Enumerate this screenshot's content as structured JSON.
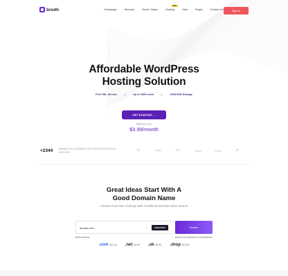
{
  "brand": {
    "name": "bredh",
    "accent": "#5b21b6",
    "signin_color": "#f0555b"
  },
  "nav": {
    "items": [
      {
        "label": "Homepage"
      },
      {
        "label": "Services"
      },
      {
        "label": "Server Status"
      },
      {
        "label": "Hosting",
        "badge": "New"
      },
      {
        "label": "Help"
      },
      {
        "label": "Pages"
      },
      {
        "label": "Contact Us"
      }
    ],
    "signin_label": "Sign in"
  },
  "hero": {
    "title_line1": "Affordable WordPress",
    "title_line2": "Hosting Solution",
    "features": [
      "Free SSL Service",
      "Up to 3400 users",
      "1008 SSD Storage"
    ],
    "cta_label": "GET STARTED  →",
    "starting_label": "Starting From",
    "price": "$3.99/month"
  },
  "clients": {
    "count": "+2344",
    "text": "BRANDS RELY ON BREDH FOR THEIR DATA HOSTING SERVICES",
    "logos": [
      "H",
      "stripe",
      "CLOUD",
      "DÖ",
      "brand",
      "envato",
      "H"
    ]
  },
  "domain": {
    "title_line1": "Great Ideas Start With A",
    "title_line2": "Good Domain Name",
    "subtitle": "Choose From 550+ Endings With Credits.Net Domain Name Search",
    "input_value": "domain.info",
    "cheapest_label": "CHEAPEST",
    "search_label": "Search",
    "bulk_label": "Bulk domains",
    "transfer_label": "Move your domains to bredhsbrand",
    "tlds": [
      {
        "name": ".com",
        "price": "$11.44"
      },
      {
        "name": ".net",
        "price": "$1.99"
      },
      {
        "name": ".uk",
        "price": "$6.99"
      },
      {
        "name": ".shop",
        "price": "$16.99"
      }
    ]
  }
}
